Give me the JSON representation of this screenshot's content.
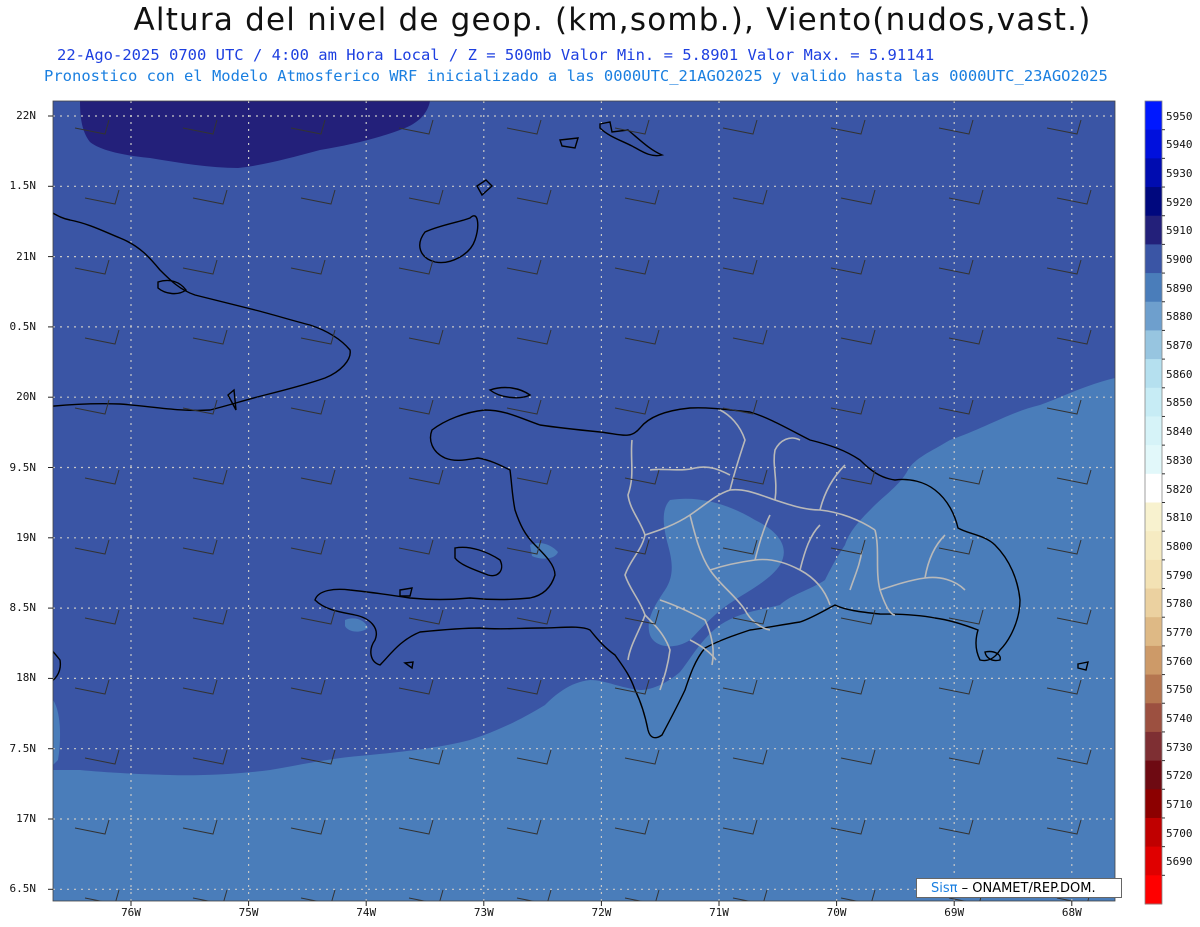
{
  "title": "Altura del nivel de geop. (km,somb.), Viento(nudos,vast.)",
  "subtitle_1": "22-Ago-2025  0700 UTC / 4:00 am Hora Local / Z = 500mb    Valor Min. = 5.8901  Valor Max. = 5.91141",
  "subtitle_2": "Pronostico con el Modelo Atmosferico WRF inicializado a las 0000UTC_21AGO2025 y valido hasta las  0000UTC_23AGO2025",
  "lat_labels": [
    "22N",
    "1.5N",
    "21N",
    "0.5N",
    "20N",
    "9.5N",
    "19N",
    "8.5N",
    "18N",
    "7.5N",
    "17N",
    "6.5N"
  ],
  "lon_labels": [
    "76W",
    "75W",
    "74W",
    "73W",
    "72W",
    "71W",
    "70W",
    "69W",
    "68W"
  ],
  "colorbar": {
    "labels": [
      "5950",
      "5940",
      "5930",
      "5920",
      "5910",
      "5900",
      "5890",
      "5880",
      "5870",
      "5860",
      "5850",
      "5840",
      "5830",
      "5820",
      "5810",
      "5800",
      "5790",
      "5780",
      "5770",
      "5760",
      "5750",
      "5740",
      "5730",
      "5720",
      "5710",
      "5700",
      "5690"
    ],
    "colors": [
      "#0018ff",
      "#0010dd",
      "#000cb0",
      "#00087e",
      "#23207a",
      "#3a55a5",
      "#4a7dba",
      "#6e9fcd",
      "#97c5e0",
      "#b5e0ef",
      "#c7ecf5",
      "#d6f3f8",
      "#e2f8fa",
      "#ffffff",
      "#f8f2cf",
      "#f6ebc2",
      "#f3e2b4",
      "#ebd1a0",
      "#deb985",
      "#cd9a68",
      "#b57650",
      "#9c5040",
      "#7e2f33",
      "#6e0a12",
      "#8c0000",
      "#c00000",
      "#e00000",
      "#ff0000"
    ]
  },
  "map_colors": {
    "level_5910": "#23207a",
    "level_5900": "#3a55a5",
    "level_5890": "#4a7dba",
    "coastline": "#000000",
    "provinces": "#b9b9b9",
    "grid": "#c8c8c8",
    "barbs": "#333333"
  },
  "credit": {
    "sis": "Sis",
    "pi": "π",
    "rest": " – ONAMET/REP.DOM."
  }
}
